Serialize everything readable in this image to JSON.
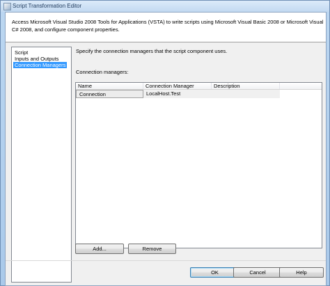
{
  "window": {
    "title": "Script Transformation Editor"
  },
  "header": {
    "text": "Access Microsoft Visual Studio 2008 Tools for Applications (VSTA) to write scripts using Microsoft Visual Basic 2008 or Microsoft Visual C# 2008, and configure component properties."
  },
  "nav": {
    "items": [
      {
        "label": "Script"
      },
      {
        "label": "Inputs and Outputs"
      },
      {
        "label": "Connection Managers",
        "selected": true
      }
    ]
  },
  "main": {
    "description": "Specify the connection managers that the script component uses.",
    "connection_managers_label": "Connection managers:",
    "grid": {
      "columns": [
        "Name",
        "Connection Manager",
        "Description"
      ],
      "rows": [
        {
          "name": "Connection",
          "connection_manager": "LocalHost.Test",
          "description": ""
        }
      ]
    },
    "add_button": "Add...",
    "remove_button": "Remove"
  },
  "footer": {
    "ok": "OK",
    "cancel": "Cancel",
    "help": "Help"
  },
  "colors": {
    "selection": "#3399ff",
    "client_background": "#f0f0f0"
  }
}
